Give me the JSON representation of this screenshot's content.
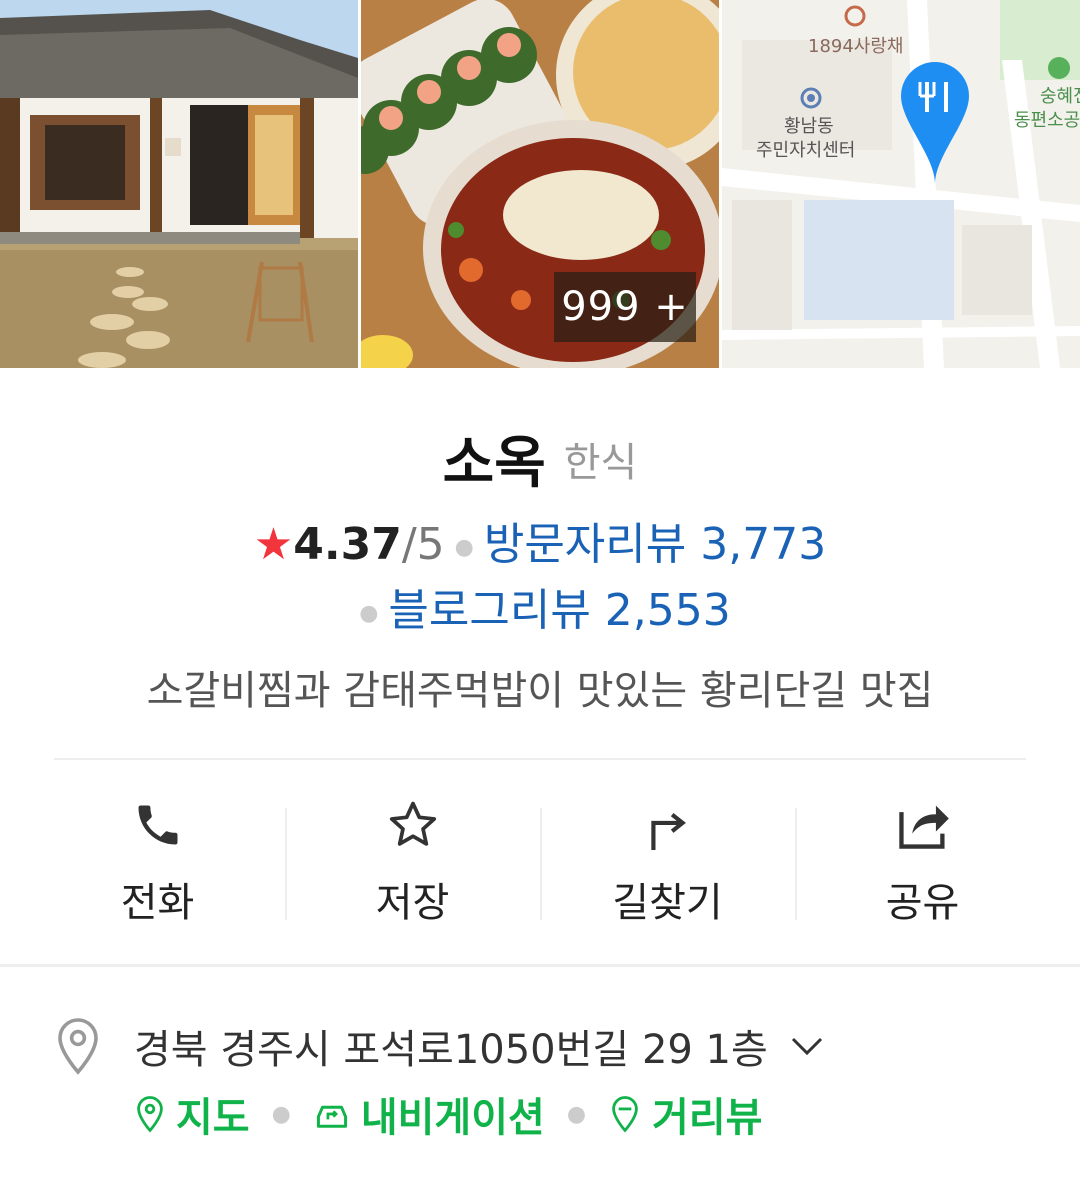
{
  "photos": {
    "more_count_label": "999 +",
    "map_labels": {
      "poi_1": "1894사랑채",
      "poi_2_line1": "황남동",
      "poi_2_line2": "주민자치센터",
      "poi_3_line1": "숭혜전",
      "poi_3_line2": "동편소공"
    }
  },
  "place": {
    "name": "소옥",
    "category": "한식",
    "rating": "4.37",
    "rating_max": "/5",
    "visitor_review": "방문자리뷰 3,773",
    "blog_review": "블로그리뷰 2,553",
    "description": "소갈비찜과 감태주먹밥이 맛있는 황리단길 맛집"
  },
  "actions": {
    "call": "전화",
    "save": "저장",
    "directions": "길찾기",
    "share": "공유"
  },
  "address": {
    "text": "경북 경주시 포석로1050번길 29 1층",
    "links": {
      "map": "지도",
      "navigation": "내비게이션",
      "street_view": "거리뷰"
    }
  },
  "colors": {
    "accent_green": "#10b34a",
    "link_blue": "#1a62b6",
    "star_red": "#f2343d",
    "map_pin_blue": "#1e8ef3"
  }
}
